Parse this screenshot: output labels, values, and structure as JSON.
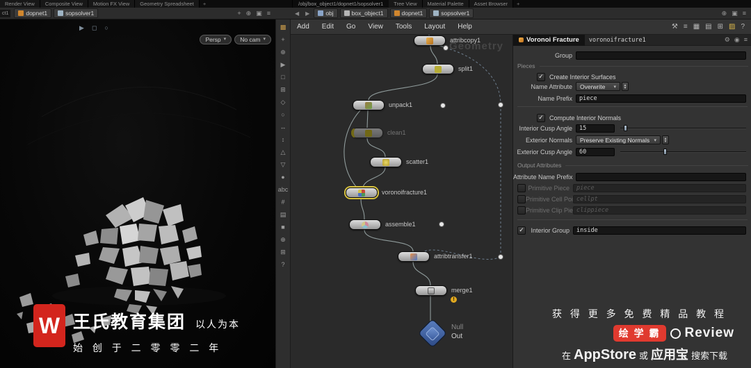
{
  "window": {
    "left_pane_tabs": [
      "Render View",
      "Composite View",
      "Motion FX View",
      "Geometry Spreadsheet"
    ],
    "new_tab_label": "+",
    "right_pane_path": "/obj/box_object1/dopnet1/sopsolver1",
    "right_pane_tabs": [
      "Tree View",
      "Material Palette",
      "Asset Browser"
    ],
    "left_edge_tab": "ct1",
    "nav_back": "◀",
    "nav_forward": "▶",
    "left_breadcrumb": [
      {
        "label": "dopnet1"
      },
      {
        "label": "sopsolver1"
      }
    ],
    "right_breadcrumb": [
      {
        "label": "obj"
      },
      {
        "label": "box_object1"
      },
      {
        "label": "dopnet1"
      },
      {
        "label": "sopsolver1"
      }
    ],
    "menu_items": [
      "Add",
      "Edit",
      "Go",
      "View",
      "Tools",
      "Layout",
      "Help"
    ],
    "menu_icons": [
      {
        "glyph": "⚒",
        "name": "build-tools-icon"
      },
      {
        "glyph": "≡",
        "name": "takes-list-icon"
      },
      {
        "glyph": "▦",
        "name": "pane-layout-grid-icon"
      },
      {
        "glyph": "▤",
        "name": "pane-layout-rows-icon"
      },
      {
        "glyph": "⊞",
        "name": "pane-split-icon"
      },
      {
        "glyph": "▨",
        "name": "shelf-toggle-icon",
        "color": "#d9b64a"
      },
      {
        "glyph": "?",
        "name": "help-icon"
      }
    ],
    "pane_corner_icons": [
      {
        "glyph": "+",
        "name": "maximize-pane-icon"
      },
      {
        "glyph": "⊕",
        "name": "pin-pane-icon"
      },
      {
        "glyph": "▣",
        "name": "link-pane-icon"
      },
      {
        "glyph": "≡",
        "name": "pane-menu-icon"
      }
    ]
  },
  "viewport": {
    "persp_label": "Persp",
    "cam_label": "No cam",
    "dropdown_arrow": "▾",
    "tool_icons": [
      {
        "glyph": "▶",
        "name": "select-arrow-icon"
      },
      {
        "glyph": "◻",
        "name": "marquee-select-icon"
      },
      {
        "glyph": "○",
        "name": "view-cycle-icon"
      }
    ]
  },
  "shelf_icons": [
    {
      "glyph": "▩",
      "name": "viewport-objects-icon"
    },
    {
      "glyph": "+",
      "name": "add-tool-icon"
    },
    {
      "glyph": "⊕",
      "name": "pivot-tool-icon"
    },
    {
      "glyph": "▶",
      "name": "select-tool-icon"
    },
    {
      "glyph": "□",
      "name": "marquee-tool-icon"
    },
    {
      "glyph": "⊞",
      "name": "grid-snap-icon"
    },
    {
      "glyph": "◇",
      "name": "primitive-tool-icon"
    },
    {
      "glyph": "○",
      "name": "orbit-tool-icon"
    },
    {
      "glyph": "↔",
      "name": "translate-x-icon"
    },
    {
      "glyph": "↕",
      "name": "translate-y-icon"
    },
    {
      "glyph": "△",
      "name": "normals-display-icon"
    },
    {
      "glyph": "▽",
      "name": "flip-normals-icon"
    },
    {
      "glyph": "●",
      "name": "point-display-icon"
    },
    {
      "glyph": "abc",
      "name": "text-overlay-icon"
    },
    {
      "glyph": "#",
      "name": "attribute-count-icon"
    },
    {
      "glyph": "▤",
      "name": "spreadsheet-icon"
    },
    {
      "glyph": "■",
      "name": "shaded-display-icon"
    },
    {
      "glyph": "⊕",
      "name": "add-view-icon"
    },
    {
      "glyph": "⊞",
      "name": "desktop-icon"
    },
    {
      "glyph": "?",
      "name": "viewport-help-icon"
    }
  ],
  "network": {
    "watermark": "Geometry",
    "warning_badge": "!",
    "nodes": [
      {
        "name": "attribcopy1"
      },
      {
        "name": "split1"
      },
      {
        "name": "unpack1"
      },
      {
        "name": "clean1"
      },
      {
        "name": "scatter1"
      },
      {
        "name": "voronoifracture1"
      },
      {
        "name": "assemble1"
      },
      {
        "name": "attribtransfer1"
      },
      {
        "name": "merge1"
      },
      {
        "name": "Out",
        "type": "Null"
      }
    ]
  },
  "params": {
    "title": "Voronoi Fracture",
    "node_name": "voronoifracture1",
    "header_icons": [
      {
        "glyph": "⚙",
        "name": "gear-icon"
      },
      {
        "glyph": "◉",
        "name": "pin-params-icon"
      },
      {
        "glyph": "≡",
        "name": "params-menu-icon"
      }
    ],
    "group_label": "Group",
    "group_value": "",
    "section_pieces": "Pieces",
    "create_interior_surfaces_label": "Create Interior Surfaces",
    "name_attribute_label": "Name Attribute",
    "name_attribute_value": "Overwrite",
    "name_prefix_label": "Name Prefix",
    "name_prefix_value": "piece",
    "compute_interior_normals_label": "Compute Interior Normals",
    "interior_cusp_label": "Interior Cusp Angle",
    "interior_cusp_value": "15",
    "exterior_normals_label": "Exterior Normals",
    "exterior_normals_value": "Preserve Existing Normals",
    "exterior_cusp_label": "Exterior Cusp Angle",
    "exterior_cusp_value": "60",
    "section_output": "Output Attributes",
    "attr_name_prefix_label": "Attribute Name Prefix",
    "attr_name_prefix_value": "",
    "primitive_piece_label": "Primitive Piece",
    "primitive_piece_value": "piece",
    "primitive_cell_label": "Primitive Cell Point",
    "primitive_cell_value": "cellpt",
    "primitive_clip_label": "Primitive Clip Piece",
    "primitive_clip_value": "clippiece",
    "interior_group_label": "Interior Group",
    "interior_group_value": "inside",
    "check_glyph": "✓",
    "dropdown_arrow": "▾",
    "spinner_up": "▲",
    "spinner_down": "▼"
  },
  "branding_left": {
    "logo_letter": "W",
    "company": "王氏教育集团",
    "slogan": "以人为本",
    "line2": "始 创 于 二 零 零 二 年"
  },
  "promo": {
    "line1": "获 得 更 多 免 费 精 品 教 程",
    "badge": "绘 学 霸",
    "brand": "Review",
    "line3_pre": "在",
    "line3_store": "AppStore",
    "line3_or": "或",
    "line3_store2": "应用宝",
    "line3_post": "搜索下载"
  },
  "colors": {
    "accent_red": "#d3251d",
    "selection_yellow": "#d8c23e",
    "null_blue": "#3b5c9e",
    "warning_yellow": "#e0a820"
  }
}
